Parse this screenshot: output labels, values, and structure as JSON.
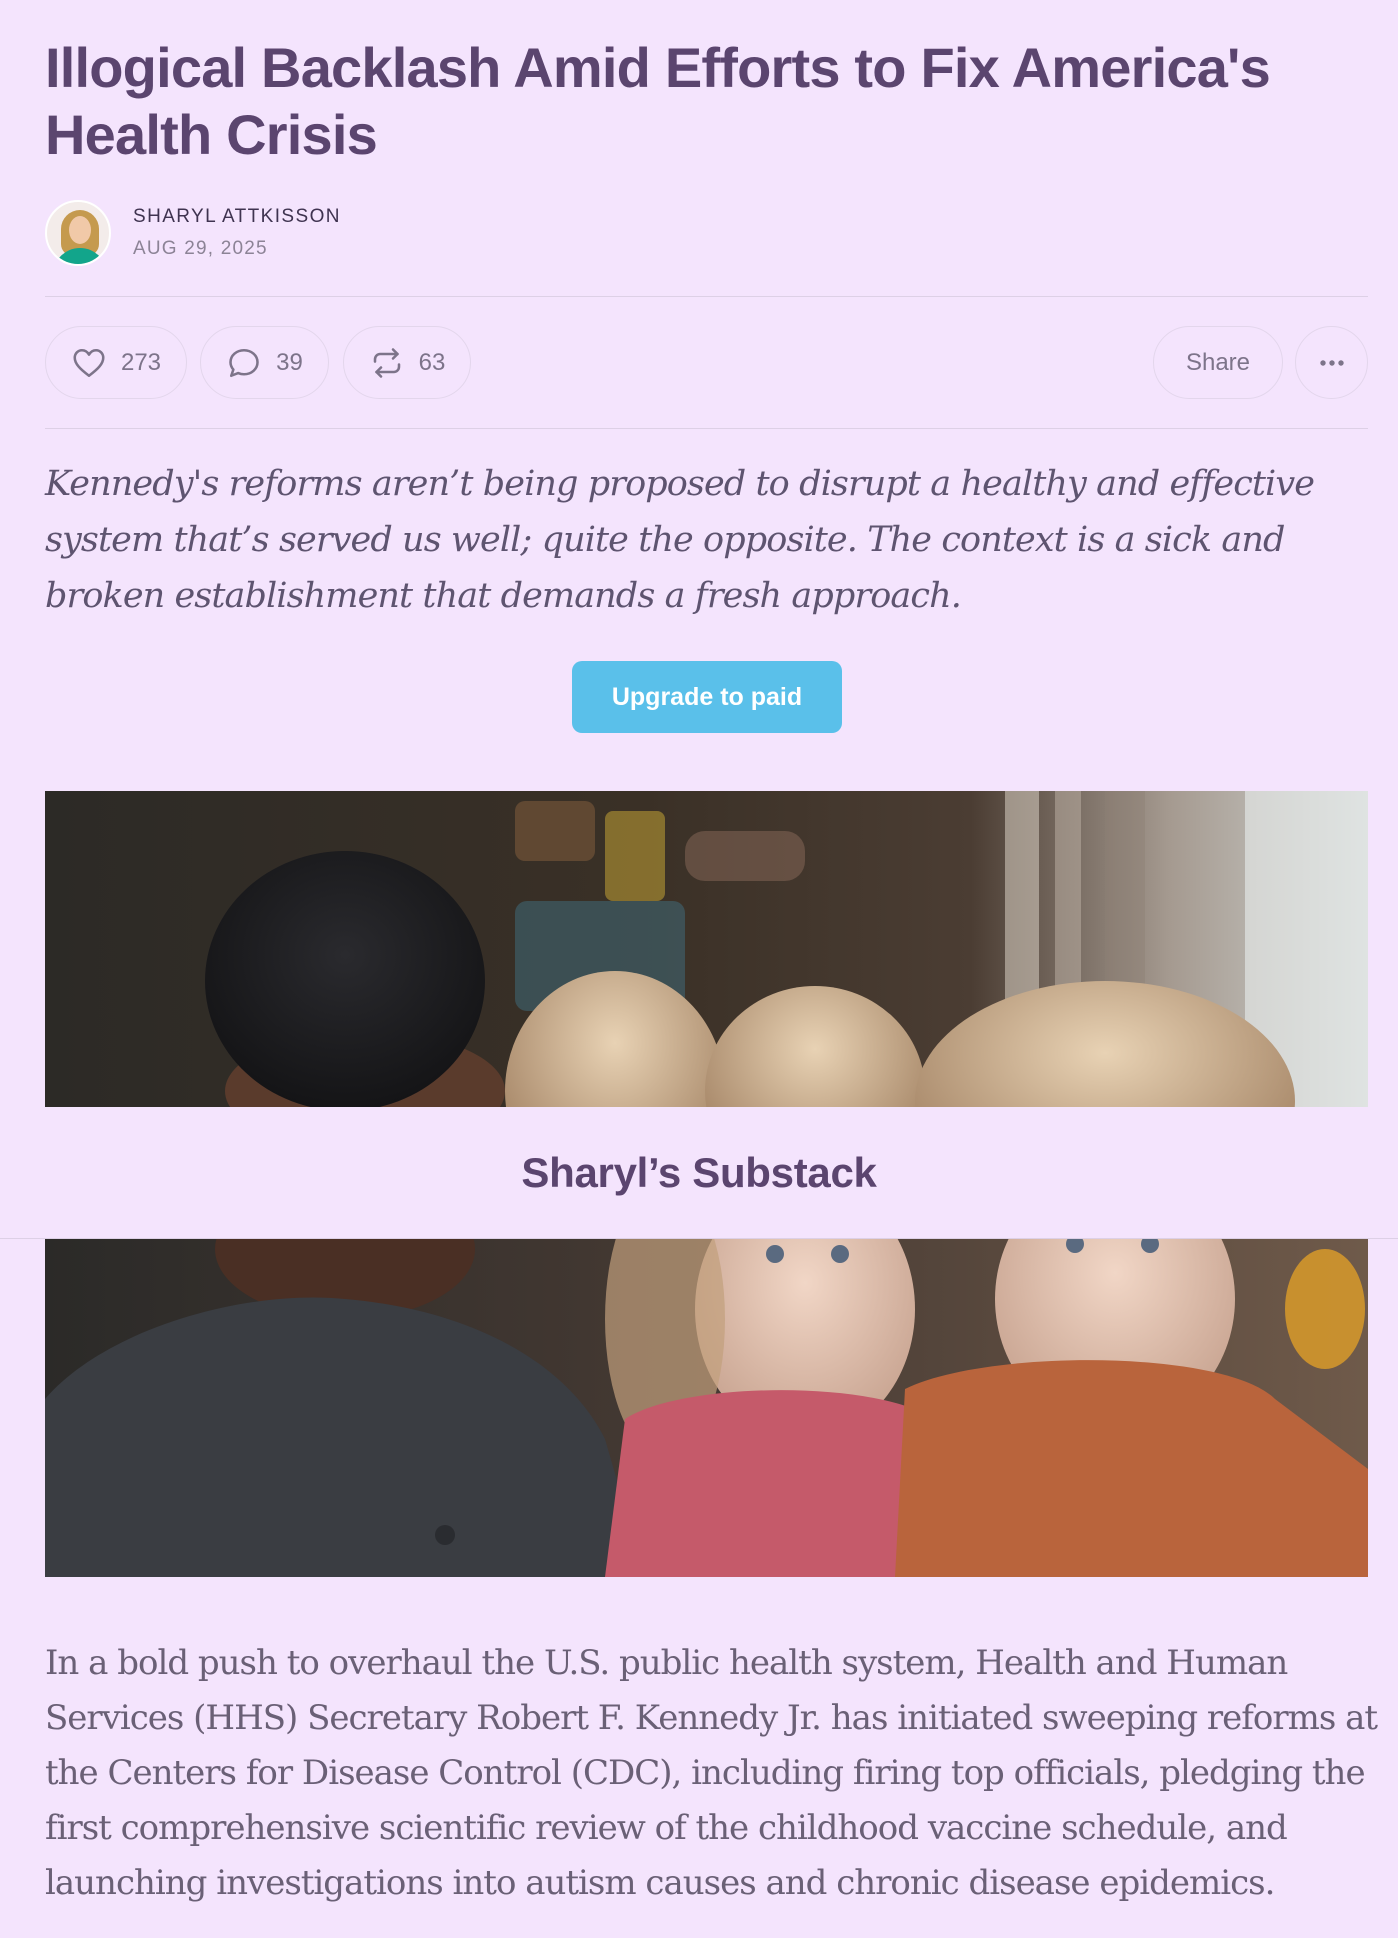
{
  "post": {
    "title": "Illogical Backlash Amid Efforts to Fix America's Health Crisis",
    "author": "SHARYL ATTKISSON",
    "date": "AUG 29, 2025",
    "subtitle": "Kennedy's reforms aren’t being proposed to disrupt a healthy and effective system that’s served us well; quite the opposite. The context is a sick and broken establishment that demands a fresh approach.",
    "body_paragraph": "In a bold push to overhaul the U.S. public health system, Health and Human Services (HHS) Secretary Robert F. Kennedy Jr. has initiated sweeping reforms at the Centers for Disease Control (CDC), including firing top officials, pledging the first comprehensive scientific review of the childhood vaccine schedule, and launching investigations into autism causes and chronic disease epidemics."
  },
  "actions": {
    "likes": "273",
    "comments": "39",
    "restacks": "63",
    "share_label": "Share",
    "like_icon": "heart-icon",
    "comment_icon": "speech-bubble-icon",
    "restack_icon": "restack-arrows-icon",
    "more_icon": "ellipsis-icon"
  },
  "cta": {
    "upgrade_label": "Upgrade to paid"
  },
  "publication": {
    "name": "Sharyl’s Substack"
  },
  "colors": {
    "background": "#f4e4fd",
    "title": "#5b456f",
    "accent_button": "#5ac0ea",
    "muted_text": "#7d748a"
  }
}
